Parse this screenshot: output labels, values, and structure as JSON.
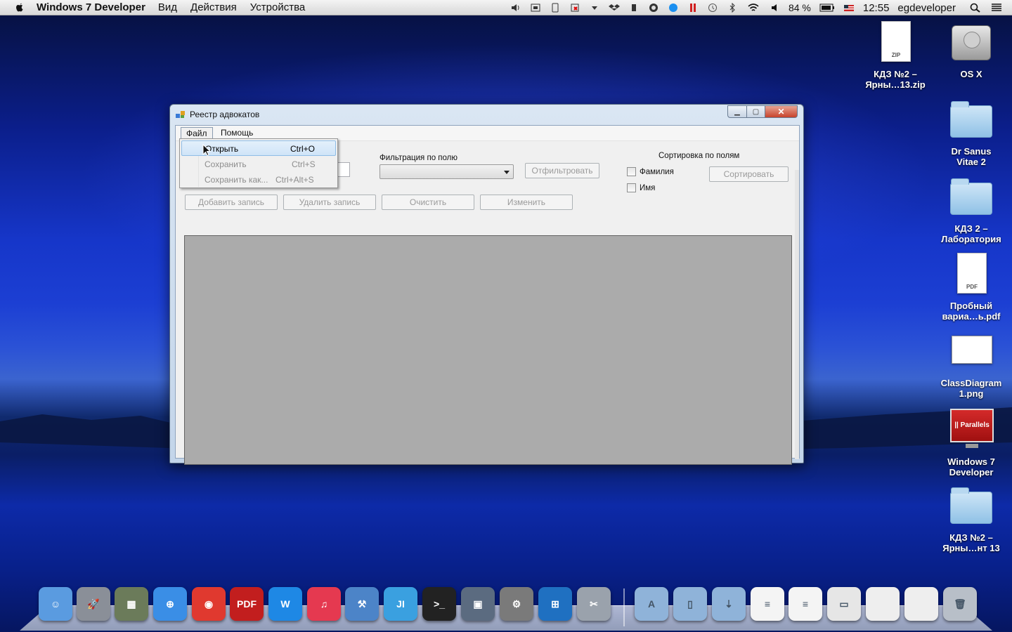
{
  "menubar": {
    "app_name": "Windows 7 Developer",
    "items": [
      "Вид",
      "Действия",
      "Устройства"
    ],
    "battery": "84 %",
    "time": "12:55",
    "user": "egdeveloper",
    "icons": [
      "apple-icon",
      "volume-icon",
      "parallels-vm-icon",
      "clipboard-icon",
      "flag-icon",
      "arrow-down-icon",
      "dropbox-icon",
      "evernote-icon",
      "target-icon",
      "shazam-icon",
      "parallels-bars-icon",
      "time-machine-icon",
      "bluetooth-icon",
      "wifi-icon",
      "volume-low-icon",
      "battery-icon",
      "us-flag-icon",
      "search-icon",
      "list-icon"
    ]
  },
  "desktop_icons": [
    {
      "label": "КДЗ №2 –\nЯрны…13.zip",
      "type": "zip",
      "tag": "ZIP"
    },
    {
      "label": "OS X",
      "type": "disk"
    },
    {
      "label": "Dr Sanus\nVitae 2",
      "type": "folder"
    },
    {
      "label": "КДЗ 2 –\nЛаборатория",
      "type": "folder"
    },
    {
      "label": "Пробный\nвариа…ь.pdf",
      "type": "pdf",
      "tag": "PDF"
    },
    {
      "label": "ClassDiagram\n1.png",
      "type": "png"
    },
    {
      "label": "Windows 7\nDeveloper",
      "type": "parallels",
      "tag": "|| Parallels"
    },
    {
      "label": "КДЗ №2 –\nЯрны…нт 13",
      "type": "folder"
    }
  ],
  "window": {
    "title": "Реестр адвокатов",
    "menu": {
      "file": "Файл",
      "help": "Помощь"
    },
    "filter_label": "Фильтрация по полю",
    "filter_button": "Отфильтровать",
    "sort_label": "Сортировка по полям",
    "sort_checkbox_1": "Фамилия",
    "sort_checkbox_2": "Имя",
    "sort_button": "Сортировать",
    "add_button": "Добавить запись",
    "delete_button": "Удалить запись",
    "clear_button": "Очистить",
    "edit_button": "Изменить"
  },
  "file_menu": [
    {
      "label": "Открыть",
      "shortcut": "Ctrl+O",
      "highlighted": true,
      "enabled": true
    },
    {
      "label": "Сохранить",
      "shortcut": "Ctrl+S",
      "highlighted": false,
      "enabled": false
    },
    {
      "label": "Сохранить как...",
      "shortcut": "Ctrl+Alt+S",
      "highlighted": false,
      "enabled": false
    }
  ],
  "dock": {
    "apps": [
      {
        "name": "finder-icon",
        "color": "#5a9be0",
        "glyph": "☺"
      },
      {
        "name": "launchpad-icon",
        "color": "#8a8f98",
        "glyph": "🚀"
      },
      {
        "name": "iphoto-icon",
        "color": "#6b7b5a",
        "glyph": "▦"
      },
      {
        "name": "safari-icon",
        "color": "#3a8ee6",
        "glyph": "⊕"
      },
      {
        "name": "chrome-icon",
        "color": "#e0392f",
        "glyph": "◉"
      },
      {
        "name": "pdf-reader-icon",
        "color": "#c21e1e",
        "glyph": "PDF"
      },
      {
        "name": "word-icon",
        "color": "#1e88e5",
        "glyph": "W"
      },
      {
        "name": "itunes-icon",
        "color": "#e53950",
        "glyph": "♫"
      },
      {
        "name": "xcode-icon",
        "color": "#4c84c8",
        "glyph": "⚒"
      },
      {
        "name": "intellij-icon",
        "color": "#3aa0e0",
        "glyph": "JI"
      },
      {
        "name": "terminal-icon",
        "color": "#222222",
        "glyph": ">_"
      },
      {
        "name": "parallels-desktop-icon",
        "color": "#5b6b80",
        "glyph": "▣"
      },
      {
        "name": "system-preferences-icon",
        "color": "#7a7a7a",
        "glyph": "⚙"
      },
      {
        "name": "windows-icon",
        "color": "#1f70c1",
        "glyph": "⊞"
      },
      {
        "name": "grab-icon",
        "color": "#9aa2ac",
        "glyph": "✂"
      }
    ],
    "right": [
      {
        "name": "applications-folder-icon",
        "color": "#8fb3d9",
        "glyph": "A"
      },
      {
        "name": "documents-folder-icon",
        "color": "#8fb3d9",
        "glyph": "▯"
      },
      {
        "name": "downloads-folder-icon",
        "color": "#8fb3d9",
        "glyph": "⇣"
      },
      {
        "name": "word-document-icon",
        "color": "#f4f4f4",
        "glyph": "≡"
      },
      {
        "name": "safari-document-icon",
        "color": "#f4f4f4",
        "glyph": "≡"
      },
      {
        "name": "window-thumbnail-icon",
        "color": "#e6e6e6",
        "glyph": "▭"
      },
      {
        "name": "minimized-window-1-icon",
        "color": "#eeeeee",
        "glyph": ""
      },
      {
        "name": "minimized-window-2-icon",
        "color": "#eeeeee",
        "glyph": ""
      },
      {
        "name": "trash-icon",
        "color": "#b8bfc8",
        "glyph": "🗑"
      }
    ]
  }
}
